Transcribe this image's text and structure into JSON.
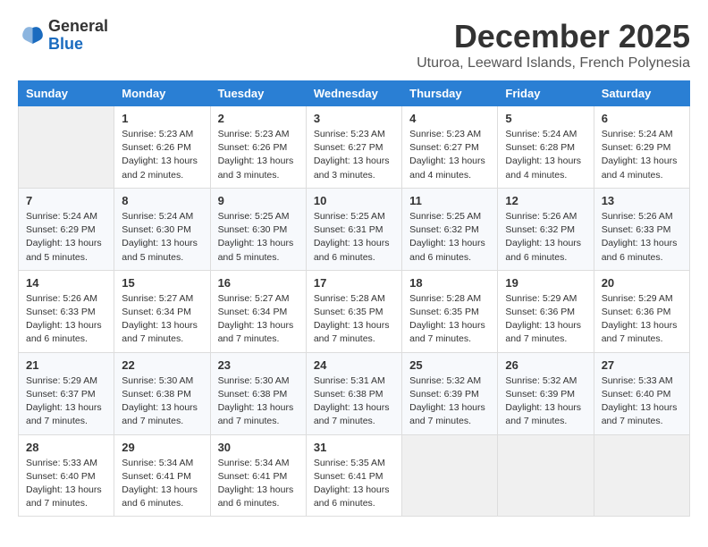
{
  "header": {
    "logo_general": "General",
    "logo_blue": "Blue",
    "month_year": "December 2025",
    "location": "Uturoa, Leeward Islands, French Polynesia"
  },
  "days_of_week": [
    "Sunday",
    "Monday",
    "Tuesday",
    "Wednesday",
    "Thursday",
    "Friday",
    "Saturday"
  ],
  "weeks": [
    [
      {
        "day": "",
        "info": ""
      },
      {
        "day": "1",
        "info": "Sunrise: 5:23 AM\nSunset: 6:26 PM\nDaylight: 13 hours\nand 2 minutes."
      },
      {
        "day": "2",
        "info": "Sunrise: 5:23 AM\nSunset: 6:26 PM\nDaylight: 13 hours\nand 3 minutes."
      },
      {
        "day": "3",
        "info": "Sunrise: 5:23 AM\nSunset: 6:27 PM\nDaylight: 13 hours\nand 3 minutes."
      },
      {
        "day": "4",
        "info": "Sunrise: 5:23 AM\nSunset: 6:27 PM\nDaylight: 13 hours\nand 4 minutes."
      },
      {
        "day": "5",
        "info": "Sunrise: 5:24 AM\nSunset: 6:28 PM\nDaylight: 13 hours\nand 4 minutes."
      },
      {
        "day": "6",
        "info": "Sunrise: 5:24 AM\nSunset: 6:29 PM\nDaylight: 13 hours\nand 4 minutes."
      }
    ],
    [
      {
        "day": "7",
        "info": "Sunrise: 5:24 AM\nSunset: 6:29 PM\nDaylight: 13 hours\nand 5 minutes."
      },
      {
        "day": "8",
        "info": "Sunrise: 5:24 AM\nSunset: 6:30 PM\nDaylight: 13 hours\nand 5 minutes."
      },
      {
        "day": "9",
        "info": "Sunrise: 5:25 AM\nSunset: 6:30 PM\nDaylight: 13 hours\nand 5 minutes."
      },
      {
        "day": "10",
        "info": "Sunrise: 5:25 AM\nSunset: 6:31 PM\nDaylight: 13 hours\nand 6 minutes."
      },
      {
        "day": "11",
        "info": "Sunrise: 5:25 AM\nSunset: 6:32 PM\nDaylight: 13 hours\nand 6 minutes."
      },
      {
        "day": "12",
        "info": "Sunrise: 5:26 AM\nSunset: 6:32 PM\nDaylight: 13 hours\nand 6 minutes."
      },
      {
        "day": "13",
        "info": "Sunrise: 5:26 AM\nSunset: 6:33 PM\nDaylight: 13 hours\nand 6 minutes."
      }
    ],
    [
      {
        "day": "14",
        "info": "Sunrise: 5:26 AM\nSunset: 6:33 PM\nDaylight: 13 hours\nand 6 minutes."
      },
      {
        "day": "15",
        "info": "Sunrise: 5:27 AM\nSunset: 6:34 PM\nDaylight: 13 hours\nand 7 minutes."
      },
      {
        "day": "16",
        "info": "Sunrise: 5:27 AM\nSunset: 6:34 PM\nDaylight: 13 hours\nand 7 minutes."
      },
      {
        "day": "17",
        "info": "Sunrise: 5:28 AM\nSunset: 6:35 PM\nDaylight: 13 hours\nand 7 minutes."
      },
      {
        "day": "18",
        "info": "Sunrise: 5:28 AM\nSunset: 6:35 PM\nDaylight: 13 hours\nand 7 minutes."
      },
      {
        "day": "19",
        "info": "Sunrise: 5:29 AM\nSunset: 6:36 PM\nDaylight: 13 hours\nand 7 minutes."
      },
      {
        "day": "20",
        "info": "Sunrise: 5:29 AM\nSunset: 6:36 PM\nDaylight: 13 hours\nand 7 minutes."
      }
    ],
    [
      {
        "day": "21",
        "info": "Sunrise: 5:29 AM\nSunset: 6:37 PM\nDaylight: 13 hours\nand 7 minutes."
      },
      {
        "day": "22",
        "info": "Sunrise: 5:30 AM\nSunset: 6:38 PM\nDaylight: 13 hours\nand 7 minutes."
      },
      {
        "day": "23",
        "info": "Sunrise: 5:30 AM\nSunset: 6:38 PM\nDaylight: 13 hours\nand 7 minutes."
      },
      {
        "day": "24",
        "info": "Sunrise: 5:31 AM\nSunset: 6:38 PM\nDaylight: 13 hours\nand 7 minutes."
      },
      {
        "day": "25",
        "info": "Sunrise: 5:32 AM\nSunset: 6:39 PM\nDaylight: 13 hours\nand 7 minutes."
      },
      {
        "day": "26",
        "info": "Sunrise: 5:32 AM\nSunset: 6:39 PM\nDaylight: 13 hours\nand 7 minutes."
      },
      {
        "day": "27",
        "info": "Sunrise: 5:33 AM\nSunset: 6:40 PM\nDaylight: 13 hours\nand 7 minutes."
      }
    ],
    [
      {
        "day": "28",
        "info": "Sunrise: 5:33 AM\nSunset: 6:40 PM\nDaylight: 13 hours\nand 7 minutes."
      },
      {
        "day": "29",
        "info": "Sunrise: 5:34 AM\nSunset: 6:41 PM\nDaylight: 13 hours\nand 6 minutes."
      },
      {
        "day": "30",
        "info": "Sunrise: 5:34 AM\nSunset: 6:41 PM\nDaylight: 13 hours\nand 6 minutes."
      },
      {
        "day": "31",
        "info": "Sunrise: 5:35 AM\nSunset: 6:41 PM\nDaylight: 13 hours\nand 6 minutes."
      },
      {
        "day": "",
        "info": ""
      },
      {
        "day": "",
        "info": ""
      },
      {
        "day": "",
        "info": ""
      }
    ]
  ]
}
